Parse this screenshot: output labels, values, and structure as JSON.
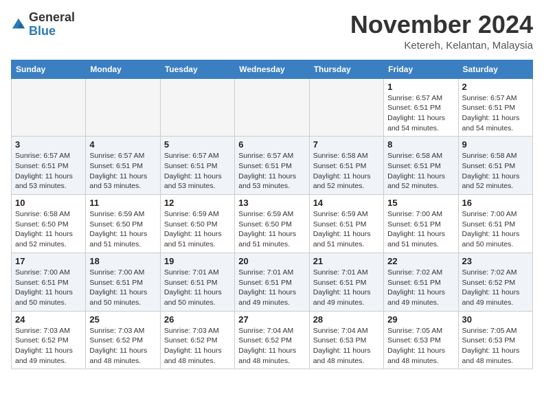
{
  "logo": {
    "general": "General",
    "blue": "Blue"
  },
  "title": "November 2024",
  "location": "Ketereh, Kelantan, Malaysia",
  "headers": [
    "Sunday",
    "Monday",
    "Tuesday",
    "Wednesday",
    "Thursday",
    "Friday",
    "Saturday"
  ],
  "weeks": [
    {
      "days": [
        {
          "num": "",
          "info": ""
        },
        {
          "num": "",
          "info": ""
        },
        {
          "num": "",
          "info": ""
        },
        {
          "num": "",
          "info": ""
        },
        {
          "num": "",
          "info": ""
        },
        {
          "num": "1",
          "info": "Sunrise: 6:57 AM\nSunset: 6:51 PM\nDaylight: 11 hours\nand 54 minutes."
        },
        {
          "num": "2",
          "info": "Sunrise: 6:57 AM\nSunset: 6:51 PM\nDaylight: 11 hours\nand 54 minutes."
        }
      ]
    },
    {
      "days": [
        {
          "num": "3",
          "info": "Sunrise: 6:57 AM\nSunset: 6:51 PM\nDaylight: 11 hours\nand 53 minutes."
        },
        {
          "num": "4",
          "info": "Sunrise: 6:57 AM\nSunset: 6:51 PM\nDaylight: 11 hours\nand 53 minutes."
        },
        {
          "num": "5",
          "info": "Sunrise: 6:57 AM\nSunset: 6:51 PM\nDaylight: 11 hours\nand 53 minutes."
        },
        {
          "num": "6",
          "info": "Sunrise: 6:57 AM\nSunset: 6:51 PM\nDaylight: 11 hours\nand 53 minutes."
        },
        {
          "num": "7",
          "info": "Sunrise: 6:58 AM\nSunset: 6:51 PM\nDaylight: 11 hours\nand 52 minutes."
        },
        {
          "num": "8",
          "info": "Sunrise: 6:58 AM\nSunset: 6:51 PM\nDaylight: 11 hours\nand 52 minutes."
        },
        {
          "num": "9",
          "info": "Sunrise: 6:58 AM\nSunset: 6:51 PM\nDaylight: 11 hours\nand 52 minutes."
        }
      ]
    },
    {
      "days": [
        {
          "num": "10",
          "info": "Sunrise: 6:58 AM\nSunset: 6:50 PM\nDaylight: 11 hours\nand 52 minutes."
        },
        {
          "num": "11",
          "info": "Sunrise: 6:59 AM\nSunset: 6:50 PM\nDaylight: 11 hours\nand 51 minutes."
        },
        {
          "num": "12",
          "info": "Sunrise: 6:59 AM\nSunset: 6:50 PM\nDaylight: 11 hours\nand 51 minutes."
        },
        {
          "num": "13",
          "info": "Sunrise: 6:59 AM\nSunset: 6:50 PM\nDaylight: 11 hours\nand 51 minutes."
        },
        {
          "num": "14",
          "info": "Sunrise: 6:59 AM\nSunset: 6:51 PM\nDaylight: 11 hours\nand 51 minutes."
        },
        {
          "num": "15",
          "info": "Sunrise: 7:00 AM\nSunset: 6:51 PM\nDaylight: 11 hours\nand 51 minutes."
        },
        {
          "num": "16",
          "info": "Sunrise: 7:00 AM\nSunset: 6:51 PM\nDaylight: 11 hours\nand 50 minutes."
        }
      ]
    },
    {
      "days": [
        {
          "num": "17",
          "info": "Sunrise: 7:00 AM\nSunset: 6:51 PM\nDaylight: 11 hours\nand 50 minutes."
        },
        {
          "num": "18",
          "info": "Sunrise: 7:00 AM\nSunset: 6:51 PM\nDaylight: 11 hours\nand 50 minutes."
        },
        {
          "num": "19",
          "info": "Sunrise: 7:01 AM\nSunset: 6:51 PM\nDaylight: 11 hours\nand 50 minutes."
        },
        {
          "num": "20",
          "info": "Sunrise: 7:01 AM\nSunset: 6:51 PM\nDaylight: 11 hours\nand 49 minutes."
        },
        {
          "num": "21",
          "info": "Sunrise: 7:01 AM\nSunset: 6:51 PM\nDaylight: 11 hours\nand 49 minutes."
        },
        {
          "num": "22",
          "info": "Sunrise: 7:02 AM\nSunset: 6:51 PM\nDaylight: 11 hours\nand 49 minutes."
        },
        {
          "num": "23",
          "info": "Sunrise: 7:02 AM\nSunset: 6:52 PM\nDaylight: 11 hours\nand 49 minutes."
        }
      ]
    },
    {
      "days": [
        {
          "num": "24",
          "info": "Sunrise: 7:03 AM\nSunset: 6:52 PM\nDaylight: 11 hours\nand 49 minutes."
        },
        {
          "num": "25",
          "info": "Sunrise: 7:03 AM\nSunset: 6:52 PM\nDaylight: 11 hours\nand 48 minutes."
        },
        {
          "num": "26",
          "info": "Sunrise: 7:03 AM\nSunset: 6:52 PM\nDaylight: 11 hours\nand 48 minutes."
        },
        {
          "num": "27",
          "info": "Sunrise: 7:04 AM\nSunset: 6:52 PM\nDaylight: 11 hours\nand 48 minutes."
        },
        {
          "num": "28",
          "info": "Sunrise: 7:04 AM\nSunset: 6:53 PM\nDaylight: 11 hours\nand 48 minutes."
        },
        {
          "num": "29",
          "info": "Sunrise: 7:05 AM\nSunset: 6:53 PM\nDaylight: 11 hours\nand 48 minutes."
        },
        {
          "num": "30",
          "info": "Sunrise: 7:05 AM\nSunset: 6:53 PM\nDaylight: 11 hours\nand 48 minutes."
        }
      ]
    }
  ]
}
